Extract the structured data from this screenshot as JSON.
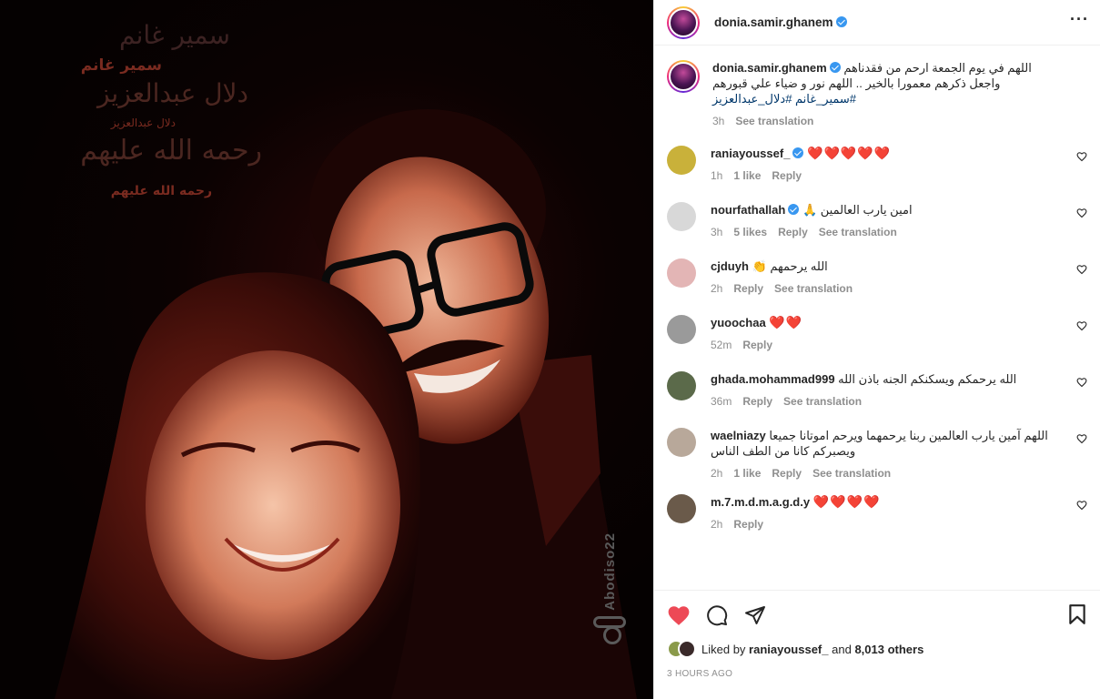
{
  "image": {
    "overlay_lines": [
      "سمير غانم",
      "سمير غانم",
      "دلال عبدالعزيز",
      "دلال عبدالعزيز",
      "رحمه الله عليهم",
      "رحمه الله عليهم"
    ],
    "watermark": "Abodiso22"
  },
  "header": {
    "username": "donia.samir.ghanem",
    "verified": true,
    "more_icon": "more-horizontal-icon"
  },
  "caption": {
    "username": "donia.samir.ghanem",
    "text_line1": "اللهم في يوم الجمعة ارحم من فقدناهم",
    "text_line2": "واجعل ذكرهم معمورا بالخير .. اللهم نور و ضياء علي قبورهم",
    "hashtags": "#سمير_غانم #دلال_عبدالعزيز",
    "time": "3h",
    "see_translation": "See translation"
  },
  "comments": [
    {
      "username": "raniayoussef_",
      "verified": true,
      "text": "",
      "hearts": "❤️❤️❤️❤️❤️",
      "time": "1h",
      "likes": "1 like",
      "reply": "Reply",
      "see_translation": "",
      "avatar_color": "#c9b13a"
    },
    {
      "username": "nourfathallah",
      "verified": true,
      "text": "امين يارب العالمين 🙏",
      "hearts": "",
      "time": "3h",
      "likes": "5 likes",
      "reply": "Reply",
      "see_translation": "See translation",
      "avatar_color": "#d8d8d8"
    },
    {
      "username": "cjduyh",
      "verified": false,
      "text": "الله يرحمهم 👏",
      "hearts": "",
      "time": "2h",
      "likes": "",
      "reply": "Reply",
      "see_translation": "See translation",
      "avatar_color": "#e3b5b5"
    },
    {
      "username": "yuoochaa",
      "verified": false,
      "text": "",
      "hearts": "❤️❤️",
      "time": "52m",
      "likes": "",
      "reply": "Reply",
      "see_translation": "",
      "avatar_color": "#9a9a9a"
    },
    {
      "username": "ghada.mohammad999",
      "verified": false,
      "text": "الله يرحمكم ويسكنكم الجنه باذن الله",
      "hearts": "",
      "time": "36m",
      "likes": "",
      "reply": "Reply",
      "see_translation": "See translation",
      "avatar_color": "#5b6a4a"
    },
    {
      "username": "waelniazy",
      "verified": false,
      "text": "اللهم آمين يارب العالمين ربنا يرحمهما ويرحم اموتانا جميعا",
      "text2": "ويصبركم كانا من الطف الناس",
      "hearts": "",
      "time": "2h",
      "likes": "1 like",
      "reply": "Reply",
      "see_translation": "See translation",
      "avatar_color": "#b8a89a"
    },
    {
      "username": "m.7.m.d.m.a.g.d.y",
      "verified": false,
      "text": "",
      "hearts": "❤️❤️❤️❤️",
      "time": "2h",
      "likes": "",
      "reply": "Reply",
      "see_translation": "",
      "avatar_color": "#6a5a4a"
    }
  ],
  "actions": {
    "like_icon": "heart-filled-icon",
    "comment_icon": "comment-icon",
    "share_icon": "send-icon",
    "save_icon": "bookmark-icon"
  },
  "likes": {
    "prefix": "Liked by",
    "user": "raniayoussef_",
    "and": "and",
    "count": "8,013 others"
  },
  "timestamp": "3 HOURS AGO",
  "colors": {
    "accent_blue": "#3897f0",
    "like_red": "#ed4956",
    "muted": "#8e8e8e"
  }
}
